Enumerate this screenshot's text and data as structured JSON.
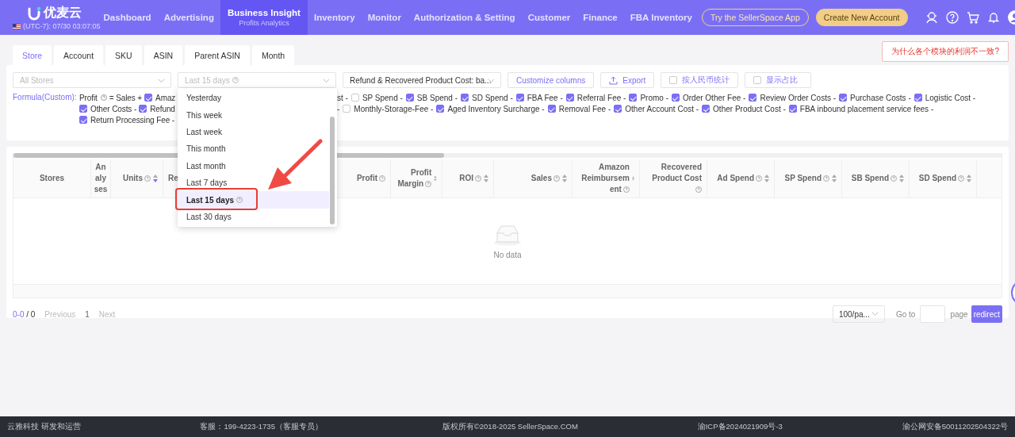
{
  "header": {
    "logo": "优麦云",
    "clock": "(UTC-7): 07/30 03:07:05",
    "nav": [
      {
        "label": "Dashboard",
        "selected": false
      },
      {
        "label": "Advertising",
        "selected": false
      },
      {
        "label": "Business Insight",
        "sub": "Profits Analytics",
        "selected": true
      },
      {
        "label": "Inventory",
        "selected": false
      },
      {
        "label": "Monitor",
        "selected": false
      },
      {
        "label": "Authorization & Setting",
        "selected": false
      },
      {
        "label": "Customer",
        "selected": false
      },
      {
        "label": "Finance",
        "selected": false
      },
      {
        "label": "FBA Inventory",
        "selected": false
      }
    ],
    "app_button": "Try the SellerSpace App",
    "create_button": "Create New Account"
  },
  "tabs": [
    {
      "label": "Store",
      "selected": true
    },
    {
      "label": "Account",
      "selected": false
    },
    {
      "label": "SKU",
      "selected": false
    },
    {
      "label": "ASIN",
      "selected": false
    },
    {
      "label": "Parent ASIN",
      "selected": false
    },
    {
      "label": "Month",
      "selected": false
    }
  ],
  "notice": "为什么各个模块的利润不一致?",
  "filters": {
    "store": {
      "placeholder": "All Stores"
    },
    "date": {
      "value": "Last 15 days"
    },
    "cost": {
      "value": "Refund & Recovered Product Cost: ba..."
    },
    "customize": "Customize columns",
    "export": "Export",
    "options": [
      {
        "label": "按人民币统计",
        "checked": false
      },
      {
        "label": "显示占比",
        "checked": false
      }
    ]
  },
  "formula": {
    "label": "Formula(Custom):",
    "rows": [
      {
        "before": [
          {
            "kind": "text",
            "text": "Profit",
            "help": true
          },
          {
            "kind": "text",
            "text": "= Sales +"
          },
          {
            "kind": "check",
            "checked": true,
            "label": "Amaz"
          }
        ],
        "after": [
          {
            "kind": "text",
            "text": "st -"
          },
          {
            "kind": "check",
            "checked": false,
            "label": "SP Spend -"
          },
          {
            "kind": "check",
            "checked": true,
            "label": "SB Spend -"
          },
          {
            "kind": "check",
            "checked": true,
            "label": "SD Spend -"
          },
          {
            "kind": "check",
            "checked": true,
            "label": "FBA Fee -"
          },
          {
            "kind": "check",
            "checked": true,
            "label": "Referral Fee -"
          },
          {
            "kind": "check",
            "checked": true,
            "label": "Promo -"
          },
          {
            "kind": "check",
            "checked": true,
            "label": "Order Other Fee -"
          },
          {
            "kind": "check",
            "checked": true,
            "label": "Review Order Costs -"
          },
          {
            "kind": "check",
            "checked": true,
            "label": "Purchase Costs -"
          },
          {
            "kind": "check",
            "checked": true,
            "label": "Logistic Cost -"
          }
        ]
      },
      {
        "before": [
          {
            "kind": "check",
            "checked": true,
            "label": "Other Costs -"
          },
          {
            "kind": "check",
            "checked": true,
            "label": "Refund"
          }
        ],
        "after": [
          {
            "kind": "text",
            "text": "-"
          },
          {
            "kind": "check",
            "checked": false,
            "label": "Monthly-Storage-Fee -"
          },
          {
            "kind": "check",
            "checked": true,
            "label": "Aged Inventory Surcharge -"
          },
          {
            "kind": "check",
            "checked": true,
            "label": "Removal Fee -"
          },
          {
            "kind": "check",
            "checked": true,
            "label": "Other Account Cost -"
          },
          {
            "kind": "check",
            "checked": true,
            "label": "Other Product Cost -"
          },
          {
            "kind": "check",
            "checked": true,
            "label": "FBA inbound placement service fees -"
          }
        ]
      },
      {
        "before": [
          {
            "kind": "check",
            "checked": true,
            "label": "Return Processing Fee -"
          }
        ],
        "after": []
      }
    ]
  },
  "dropdown": {
    "options": [
      {
        "label": "Yesterday",
        "selected": false
      },
      {
        "label": "This week",
        "selected": false
      },
      {
        "label": "Last week",
        "selected": false
      },
      {
        "label": "This month",
        "selected": false
      },
      {
        "label": "Last month",
        "selected": false
      },
      {
        "label": "Last 7 days",
        "selected": false
      },
      {
        "label": "Last 15 days",
        "help": true,
        "selected": true
      },
      {
        "label": "Last 30 days",
        "selected": false
      }
    ]
  },
  "table": {
    "columns": [
      {
        "label": "Stores"
      },
      {
        "label": "Analyses"
      },
      {
        "label": "Units",
        "help": true,
        "sorted": true
      },
      {
        "label": "Re"
      },
      {
        "label": "Profit",
        "help": true
      },
      {
        "label": "Profit Margin",
        "help": true,
        "sorted": false
      },
      {
        "label": "ROI",
        "help": true,
        "sorted": false
      },
      {
        "label": "Sales",
        "help": true,
        "sorted": false
      },
      {
        "label": "Amazon Reimbursement",
        "help": true,
        "sorted": false
      },
      {
        "label": "Recovered Product Cost",
        "help": true
      },
      {
        "label": "Ad Spend",
        "help": true,
        "sorted": false
      },
      {
        "label": "SP Spend",
        "help": true,
        "sorted": false
      },
      {
        "label": "SB Spend",
        "help": true,
        "sorted": false
      },
      {
        "label": "SD Spend",
        "help": true,
        "sorted": false
      }
    ],
    "empty": "No data"
  },
  "pagination": {
    "range": "0-0",
    "total": "/ 0",
    "previous": "Previous",
    "page": "1",
    "next": "Next",
    "page_size": "100/pa...",
    "goto": "Go to",
    "page_label": "page",
    "redirect": "redirect"
  },
  "footer": [
    "云雅科技 研发和运营",
    "客服：199-4223-1735（客服专员）",
    "版权所有©2018-2025 SellerSpace.COM",
    "渝ICP备2024021909号-3",
    "渝公网安备50011202504322号"
  ]
}
